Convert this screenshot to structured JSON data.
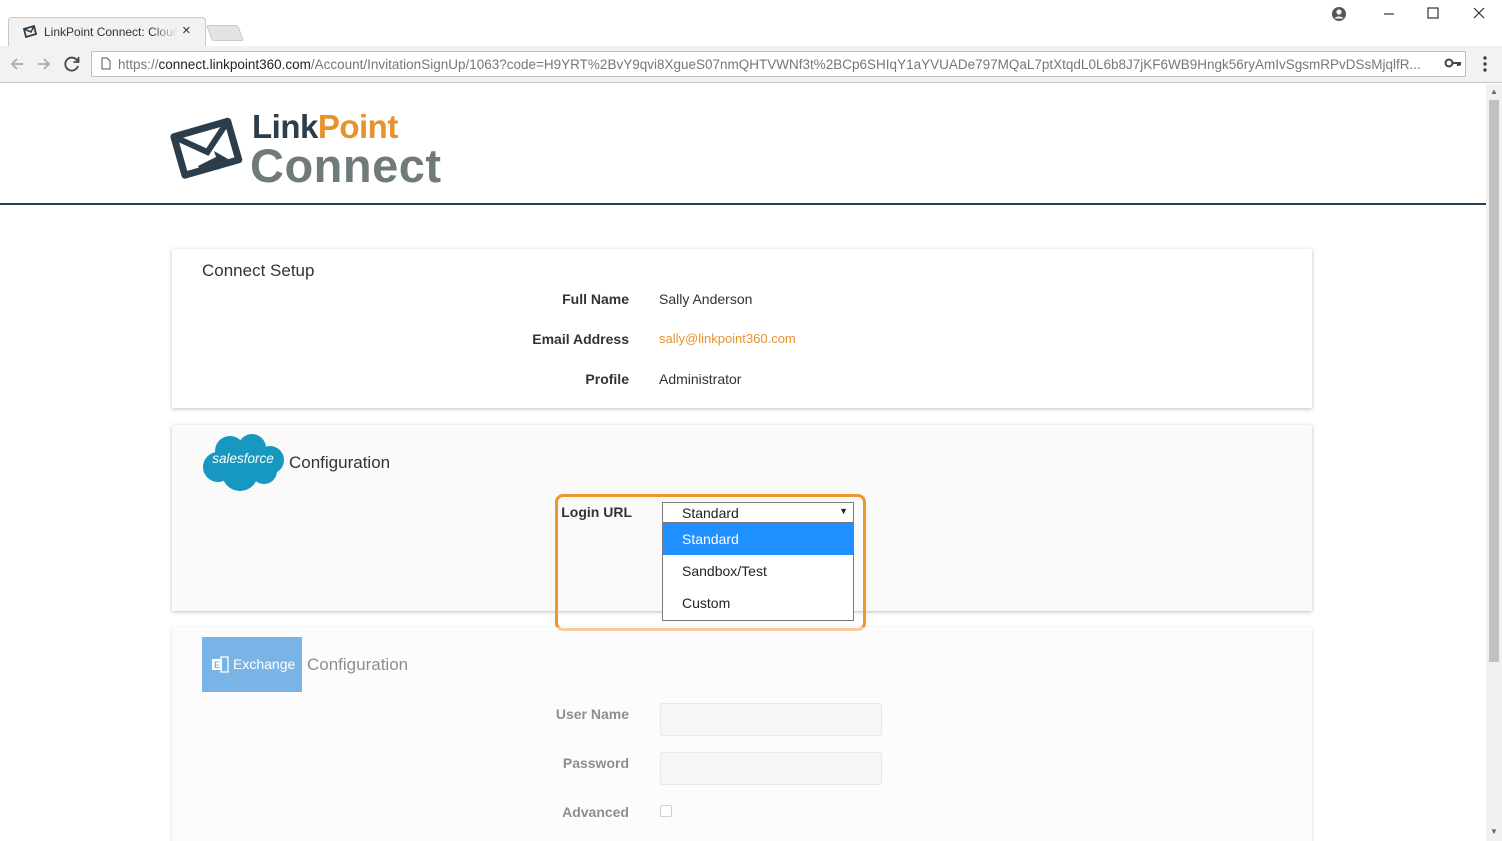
{
  "browser": {
    "tab_title": "LinkPoint Connect: Cloud",
    "tab_close": "×",
    "url_scheme": "https://",
    "url_host": "connect.linkpoint360.com",
    "url_path": "/Account/InvitationSignUp/1063?code=H9YRT%2BvY9qvi8XgueS07nmQHTVWNf3t%2BCp6SHIqY1aYVUADe797MQaL7ptXtqdL0L6b8J7jKF6WB9Hngk56ryAmIvSgsmRPvDSsMjqlfR..."
  },
  "logo": {
    "line1_a": "Link",
    "line1_b": "Point",
    "line2": "Connect"
  },
  "setup": {
    "title": "Connect Setup",
    "fields": [
      {
        "label": "Full Name",
        "value": "Sally Anderson"
      },
      {
        "label": "Email Address",
        "value": "sally@linkpoint360.com"
      },
      {
        "label": "Profile",
        "value": "Administrator"
      }
    ]
  },
  "salesforce": {
    "logo_text": "salesforce",
    "title": "Configuration",
    "login_url_label": "Login URL",
    "login_url_selected": "Standard",
    "login_url_options": [
      "Standard",
      "Sandbox/Test",
      "Custom"
    ]
  },
  "exchange": {
    "logo_text": "Exchange",
    "title": "Configuration",
    "username_label": "User Name",
    "password_label": "Password",
    "advanced_label": "Advanced"
  },
  "colors": {
    "accent_orange": "#f0962f",
    "brand_navy": "#2c3e4c",
    "select_highlight": "#1e90ff",
    "salesforce_blue": "#1798c1",
    "exchange_blue": "#0f78d4"
  }
}
